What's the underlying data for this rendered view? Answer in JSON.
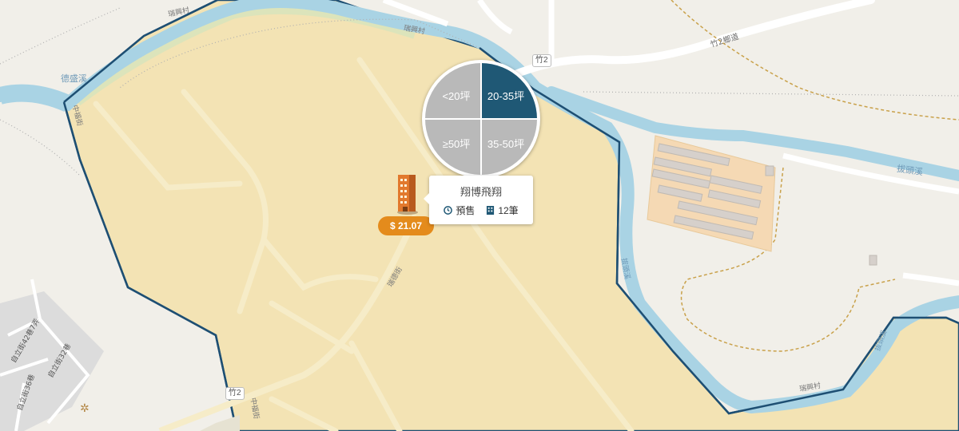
{
  "map": {
    "labels": {
      "river_west": "德盛溪",
      "river_east": "拔頭溪",
      "river_south_1": "拔頭溪",
      "river_south_2": "拔頭溪",
      "road_zhu2": "竹2鄉道",
      "village_top": "瑞興村",
      "village_top2": "瑞興村",
      "village_bottom": "瑞興村",
      "street_south": "瑞德街",
      "street_west": "中福街",
      "street_west2": "中福街",
      "alley_1": "自立街42巷7弄",
      "alley_2": "自立街36巷",
      "alley_3": "自立街32巷"
    },
    "shields": {
      "zhu2_top": "竹2",
      "zhu2_bottom": "竹2"
    },
    "colors": {
      "district": "#f3e3b4",
      "district_border": "#1e4f73",
      "water": "#a9d3e4",
      "road": "#ffffff",
      "road_minor": "#f6ecc8"
    }
  },
  "filter_wheel": {
    "segments": [
      {
        "label": "<20坪",
        "active": false
      },
      {
        "label": "20-35坪",
        "active": true
      },
      {
        "label": "≥50坪",
        "active": false
      },
      {
        "label": "35-50坪",
        "active": false
      }
    ]
  },
  "project": {
    "name": "翔博飛翔",
    "status": "預售",
    "count": "12筆",
    "price": "$ 21.07",
    "icons": [
      "clock-icon",
      "building-icon"
    ]
  }
}
